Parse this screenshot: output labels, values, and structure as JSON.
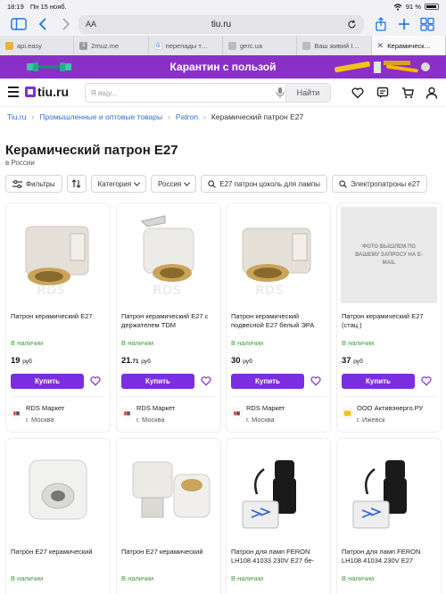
{
  "status_bar": {
    "time": "18:19",
    "date": "Пн 15 нояб.",
    "battery": "91 %"
  },
  "browser": {
    "aa_label": "AA",
    "host": "tiu.ru",
    "tabs": [
      {
        "label": "api.easy",
        "active": false
      },
      {
        "label": "2muz.me",
        "active": false
      },
      {
        "label": "перепады т…",
        "active": false
      },
      {
        "label": "gerc.ua",
        "active": false
      },
      {
        "label": "Ваш живий І…",
        "active": false
      },
      {
        "label": "Керамическ…",
        "active": true
      }
    ]
  },
  "banner": {
    "text": "Карантин с пользой",
    "bg_color": "#8b2fc9"
  },
  "header": {
    "logo_text": "tiu.ru",
    "search_placeholder": "Я ищу...",
    "search_button": "Найти",
    "icons": [
      "heart-icon",
      "chat-icon",
      "cart-icon",
      "user-icon"
    ]
  },
  "breadcrumb": {
    "items": [
      "Tiu.ru",
      "Промышленные и оптовые товары",
      "Patron"
    ],
    "current": "Керамический патрон E27"
  },
  "page": {
    "title": "Керамический патрон E27",
    "subtitle": "в России"
  },
  "filters": {
    "filters_label": "Фильтры",
    "category_label": "Категория",
    "region_label": "Россия",
    "query1": "E27 патрон цоколь для лампы",
    "query2": "Электропатроны е27"
  },
  "placeholder_image_text": "ФОТО ВЫШЛЕМ ПО ВАШЕМУ ЗАПРОСУ НА E-MAIL",
  "products": [
    {
      "name": "Патрон керамический E27",
      "stock": "В наличии",
      "price_main": "19",
      "price_kop": "",
      "price_unit": "руб",
      "buy_label": "Купить",
      "seller": "RDS Маркет",
      "city": "г. Москва"
    },
    {
      "name": "Патрон керамический E27 с держателем TDM",
      "stock": "В наличии",
      "price_main": "21",
      "price_kop": ".71",
      "price_unit": "руб",
      "buy_label": "Купить",
      "seller": "RDS Маркет",
      "city": "г. Москва"
    },
    {
      "name": "Патрон керамический подвесной E27 белый ЭРА",
      "stock": "В наличии",
      "price_main": "30",
      "price_kop": "",
      "price_unit": "руб",
      "buy_label": "Купить",
      "seller": "RDS Маркет",
      "city": "г. Москва"
    },
    {
      "name": "Патрон керамический E27 (стац.)",
      "stock": "В наличии",
      "price_main": "37",
      "price_kop": "",
      "price_unit": "руб",
      "buy_label": "Купить",
      "seller": "ООО Активэнерго.РУ",
      "city": "г. Ижевск"
    },
    {
      "name": "Патрон E27 керамический",
      "stock": "В наличии"
    },
    {
      "name": "Патрон E27 керамический",
      "stock": "В наличии"
    },
    {
      "name": "Патрон для ламп FERON LH108 41033 230V E27 бе-",
      "stock": "В наличии"
    },
    {
      "name": "Патрон для ламп FERON LH108 41034 230V E27",
      "stock": "В наличии"
    }
  ]
}
